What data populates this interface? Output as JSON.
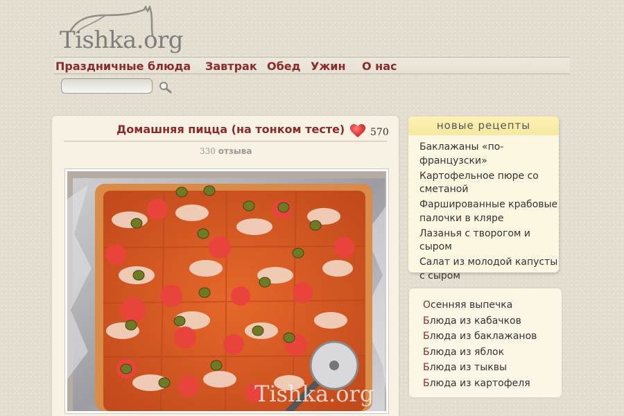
{
  "logo": {
    "text": "Tishka.org"
  },
  "nav": {
    "items": [
      "Праздничные блюда",
      "Завтрак",
      "Обед",
      "Ужин",
      "О нас"
    ]
  },
  "search": {
    "value": "",
    "placeholder": ""
  },
  "recipe": {
    "title": "Домашняя пицца (на тонком тесте)",
    "likes": "570",
    "reviews_count": "330",
    "reviews_label": "отзыва",
    "watermark": "Tishka.org"
  },
  "new_recipes": {
    "heading": "новые рецепты",
    "items": [
      "Баклажаны «по-французски»",
      "Картофельное пюре со сметаной",
      "Фаршированные крабовые палочки в кляре",
      "Лазанья с творогом и сыром",
      "Салат из молодой капусты с сыром"
    ]
  },
  "categories": {
    "items": [
      "Осенняя выпечка",
      "Блюда из кабачков",
      "Блюда из баклажанов",
      "Блюда из яблок",
      "Блюда из тыквы",
      "Блюда из картофеля"
    ]
  },
  "colors": {
    "accent": "#8c2a2a",
    "page_bg": "#e2ddcf",
    "card_bg": "#f7f2e4",
    "heading_yellow": "#fdf1b6"
  },
  "icons": [
    "cat-logo-icon",
    "magnifier-icon",
    "heart-icon",
    "pizza-cutter-icon"
  ]
}
